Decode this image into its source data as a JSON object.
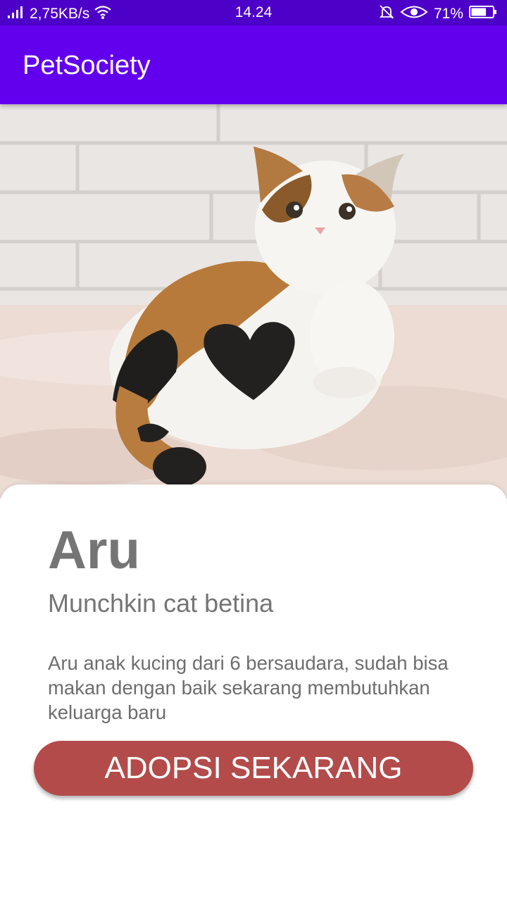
{
  "status_bar": {
    "network_speed": "2,75KB/s",
    "time": "14.24",
    "battery_percent": "71%",
    "battery_level": 0.71,
    "icons": [
      "signal-icon",
      "wifi-icon",
      "mute-icon",
      "eye-icon",
      "battery-icon"
    ]
  },
  "app_bar": {
    "title": "PetSociety"
  },
  "pet": {
    "name": "Aru",
    "breed": "Munchkin cat betina",
    "description": "Aru anak kucing dari 6 bersaudara, sudah bisa makan dengan baik sekarang membutuhkan keluarga baru"
  },
  "actions": {
    "adopt_label": "ADOPSI SEKARANG"
  },
  "colors": {
    "status_bar": "#4d00c8",
    "app_bar": "#6200ee",
    "adopt_button": "#b34b4b",
    "text_gray": "#757575"
  }
}
